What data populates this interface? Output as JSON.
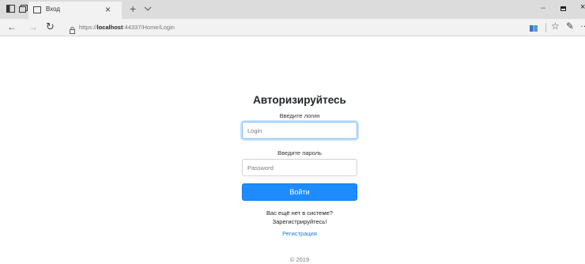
{
  "browser": {
    "tab_title": "Вход",
    "tab_close": "×",
    "new_tab": "+",
    "url_scheme": "https://",
    "url_host": "localhost",
    "url_rest": ":44337/Home/Login",
    "icons": [
      "tab-actions-icon",
      "tab-aside-icon",
      "page-favicon-icon",
      "tab-list-icon",
      "back-icon",
      "forward-icon",
      "reload-icon",
      "lock-icon",
      "reading-view-icon",
      "favorites-icon",
      "notes-icon",
      "more-icon",
      "minimize-icon",
      "maximize-icon",
      "close-window-icon"
    ]
  },
  "login": {
    "heading": "Авторизируйтесь",
    "login_label": "Введите логин",
    "login_placeholder": "Login",
    "login_value": "",
    "password_label": "Введите пароль",
    "password_placeholder": "Password",
    "password_value": "",
    "submit_label": "Войти",
    "prompt_line1": "Вас ещё нет в системе?",
    "prompt_line2": "Зарегистрируйтесь!",
    "register_link": "Регистрация",
    "footer": "© 2019"
  },
  "colors": {
    "primary_button": "#1e8cff",
    "link": "#1e7bd8",
    "focus_border": "#80bdff"
  }
}
